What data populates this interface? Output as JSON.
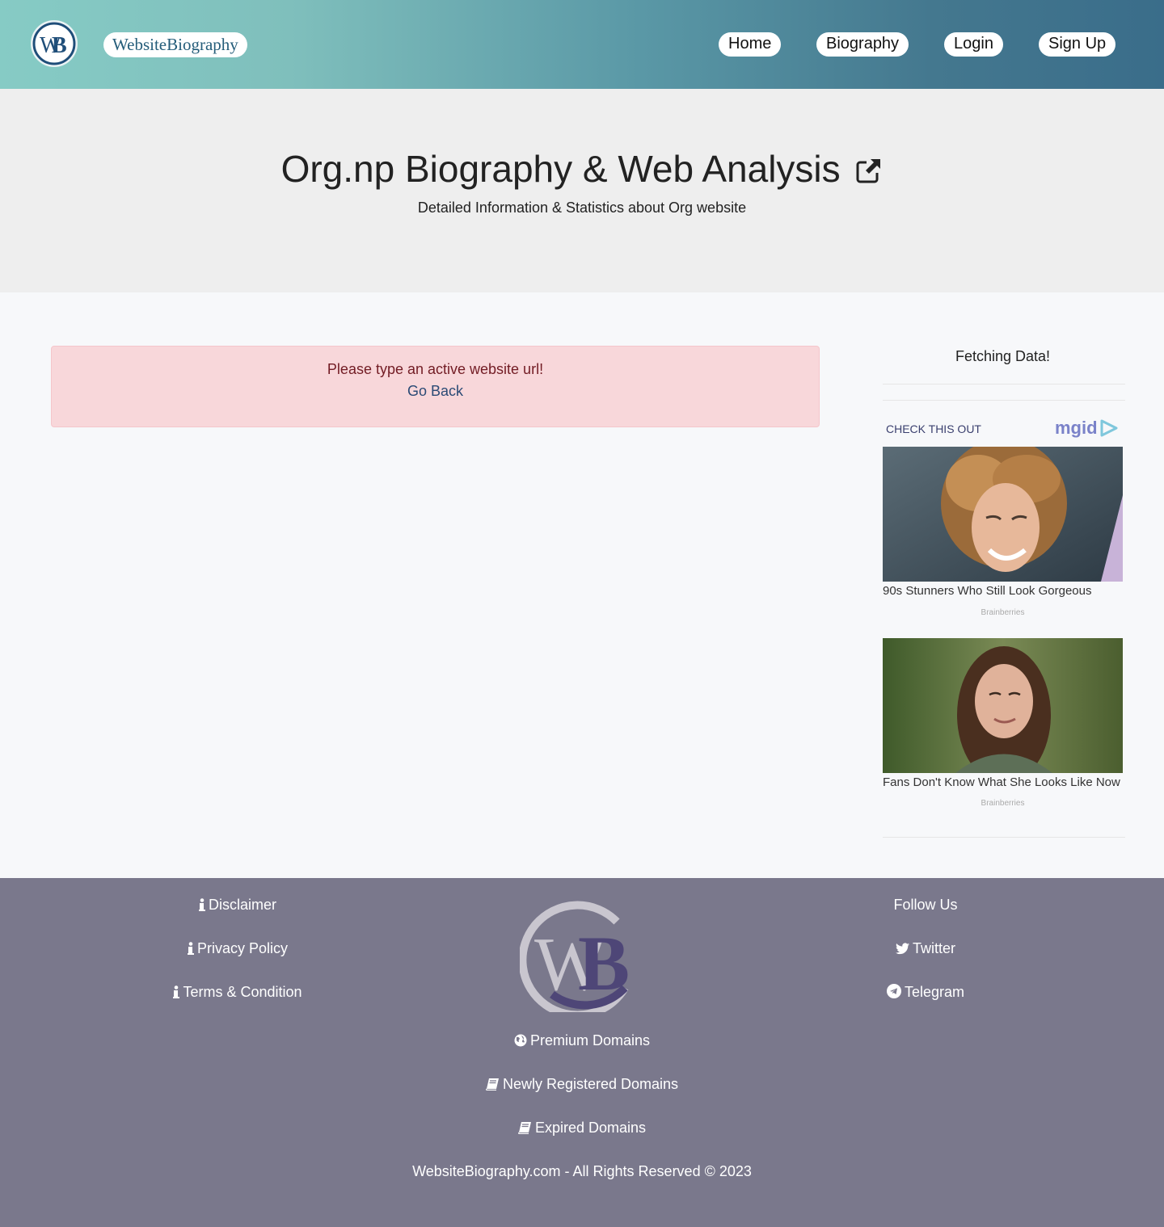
{
  "header": {
    "brand": "WebsiteBiography",
    "nav": [
      "Home",
      "Biography",
      "Login",
      "Sign Up"
    ]
  },
  "hero": {
    "title": "Org.np Biography & Web Analysis",
    "subtitle": "Detailed Information & Statistics about Org website"
  },
  "alert": {
    "message": "Please type an active website url!",
    "link": "Go Back"
  },
  "sidebar": {
    "status": "Fetching Data!",
    "widget_label": "CHECK THIS OUT",
    "ads": [
      {
        "title": "90s Stunners Who Still Look Gorgeous",
        "source": "Brainberries"
      },
      {
        "title": "Fans Don't Know What She Looks Like Now",
        "source": "Brainberries"
      }
    ]
  },
  "footer": {
    "left_links": [
      "Disclaimer",
      "Privacy Policy",
      "Terms & Condition"
    ],
    "follow_title": "Follow Us",
    "social": [
      "Twitter",
      "Telegram"
    ],
    "center_links": [
      "Premium Domains",
      "Newly Registered Domains",
      "Expired Domains"
    ],
    "copyright": "WebsiteBiography.com - All Rights Reserved © 2023"
  },
  "colors": {
    "header_gradient_start": "#86cbc5",
    "header_gradient_end": "#3a6d8a",
    "hero_bg": "#eeeeee",
    "alert_bg": "#f8d7da",
    "alert_text": "#721c24",
    "footer_bg": "#7a788c"
  },
  "icons": {
    "logo": "wb-logo",
    "title_link": "external-link-icon",
    "footer_info": "info-icon",
    "twitter": "twitter-icon",
    "telegram": "telegram-icon",
    "premium": "globe-icon",
    "domains": "book-icon"
  }
}
